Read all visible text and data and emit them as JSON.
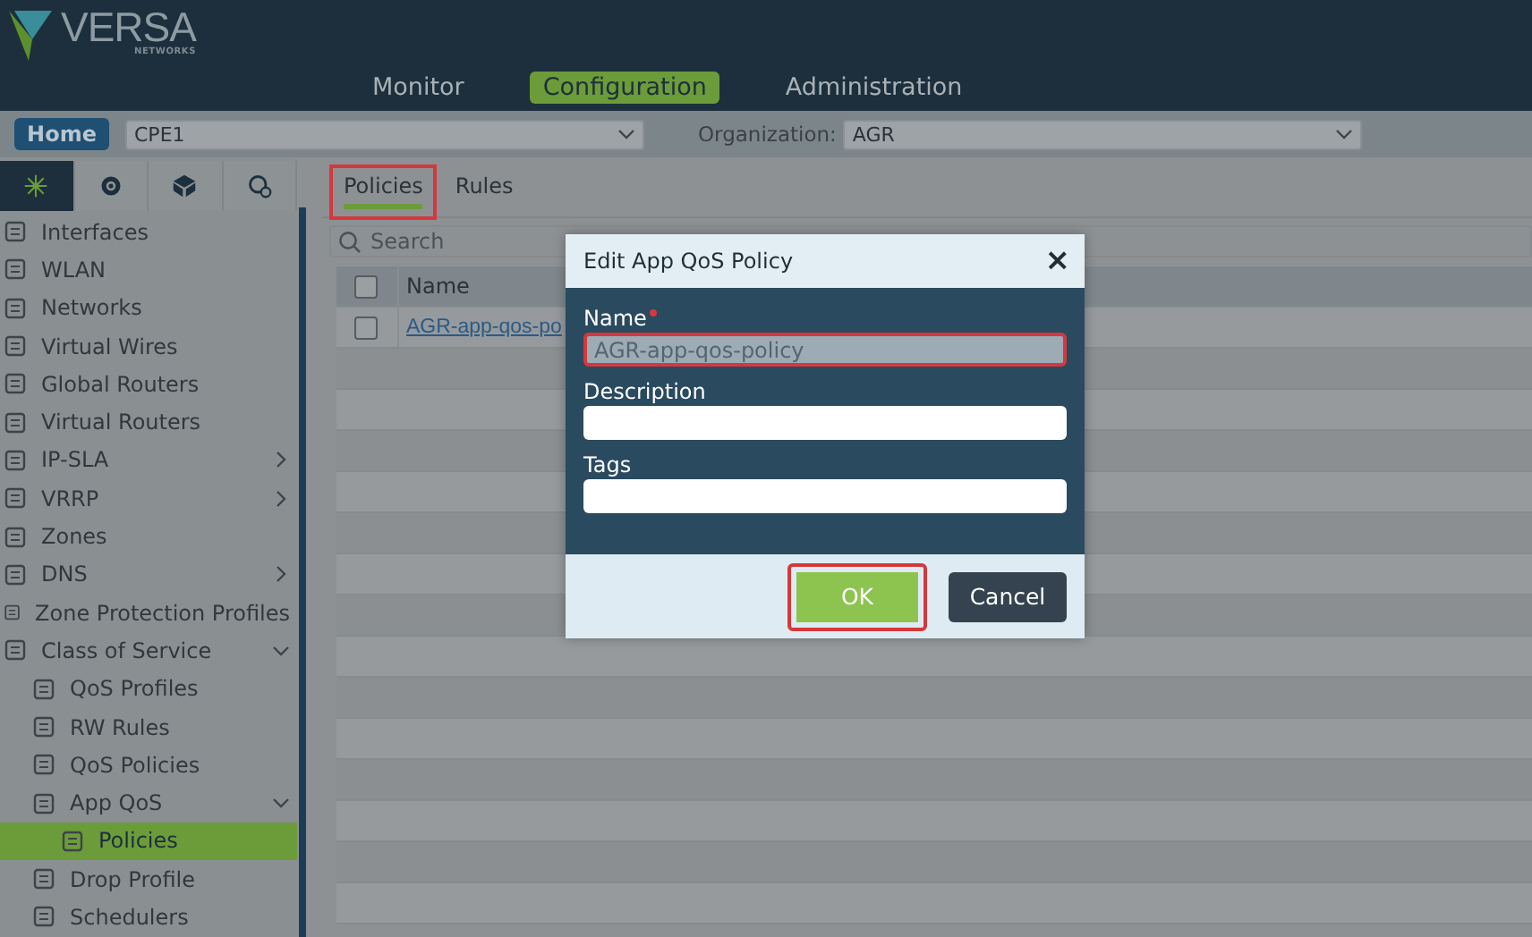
{
  "header": {
    "logo": {
      "name": "VERSA",
      "subtitle": "NETWORKS"
    },
    "nav": [
      {
        "label": "Monitor",
        "selected": false
      },
      {
        "label": "Configuration",
        "selected": true
      },
      {
        "label": "Administration",
        "selected": false
      }
    ]
  },
  "toolbar": {
    "home_button": "Home",
    "device": "CPE1",
    "organization_label": "Organization:",
    "organization": "AGR"
  },
  "sidebar": {
    "icon_tabs": [
      {
        "selected": true
      },
      {
        "selected": false
      },
      {
        "selected": false
      },
      {
        "selected": false
      }
    ],
    "items": [
      {
        "label": "Interfaces",
        "kind": "leaf",
        "selected": false
      },
      {
        "label": "WLAN",
        "kind": "leaf",
        "selected": false
      },
      {
        "label": "Networks",
        "kind": "leaf",
        "selected": false
      },
      {
        "label": "Virtual Wires",
        "kind": "leaf",
        "selected": false
      },
      {
        "label": "Global Routers",
        "kind": "leaf",
        "selected": false
      },
      {
        "label": "Virtual Routers",
        "kind": "leaf",
        "selected": false
      },
      {
        "label": "IP-SLA",
        "kind": "group",
        "expanded": false,
        "selected": false
      },
      {
        "label": "VRRP",
        "kind": "group",
        "expanded": false,
        "selected": false
      },
      {
        "label": "Zones",
        "kind": "leaf",
        "selected": false
      },
      {
        "label": "DNS",
        "kind": "group",
        "expanded": false,
        "selected": false
      },
      {
        "label": "Zone Protection Profiles",
        "kind": "leaf",
        "selected": false
      },
      {
        "label": "Class of Service",
        "kind": "group",
        "expanded": true,
        "selected": false,
        "children": [
          {
            "label": "QoS Profiles",
            "kind": "leaf",
            "selected": false
          },
          {
            "label": "RW Rules",
            "kind": "leaf",
            "selected": false
          },
          {
            "label": "QoS Policies",
            "kind": "leaf",
            "selected": false
          },
          {
            "label": "App QoS",
            "kind": "group",
            "expanded": true,
            "selected": false,
            "children": [
              {
                "label": "Policies",
                "kind": "leaf",
                "selected": true
              }
            ]
          },
          {
            "label": "Drop Profile",
            "kind": "leaf",
            "selected": false
          },
          {
            "label": "Schedulers",
            "kind": "leaf",
            "selected": false
          }
        ]
      }
    ]
  },
  "content": {
    "tabs": [
      {
        "label": "Policies",
        "selected": true,
        "highlighted": true
      },
      {
        "label": "Rules",
        "selected": false,
        "highlighted": false
      }
    ],
    "search": {
      "placeholder": "Search"
    },
    "table": {
      "columns": [
        "Name"
      ],
      "header_checked": false,
      "rows": [
        {
          "checked": false,
          "name": "AGR-app-qos-po"
        }
      ]
    }
  },
  "dialog": {
    "title": "Edit App QoS Policy",
    "close": "×",
    "fields": [
      {
        "label": "Name",
        "required": true,
        "value": "AGR-app-qos-policy",
        "disabled": true,
        "highlighted": true
      },
      {
        "label": "Description",
        "required": false,
        "disabled": false,
        "highlighted": false
      },
      {
        "label": "Tags",
        "required": false,
        "disabled": false,
        "highlighted": false
      }
    ],
    "buttons": [
      {
        "label": "OK",
        "kind": "primary",
        "highlighted": true
      },
      {
        "label": "Cancel",
        "kind": "secondary",
        "highlighted": false
      }
    ]
  }
}
